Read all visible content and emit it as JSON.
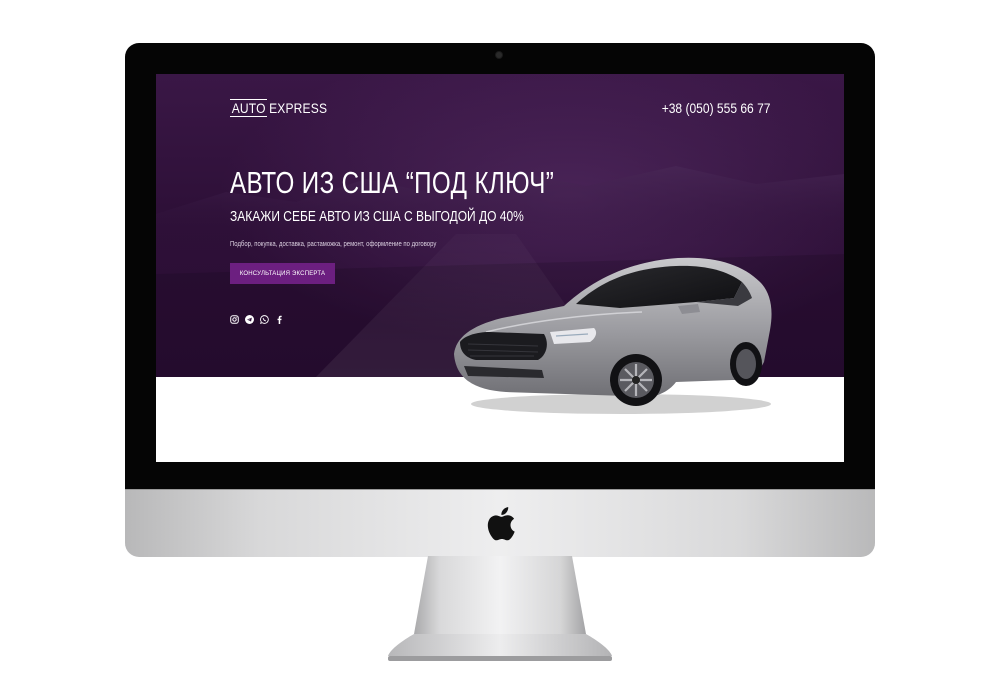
{
  "site": {
    "logo": {
      "part1": "AUTO",
      "part2": "EXPRESS"
    },
    "phone": "+38 (050) 555 66 77",
    "hero": {
      "title": "АВТО ИЗ США “ПОД КЛЮЧ”",
      "subtitle": "ЗАКАЖИ СЕБЕ АВТО ИЗ США С ВЫГОДОЙ ДО 40%",
      "description": "Подбор, покупка, доставка, растаможка, ремонт, оформление по договору",
      "cta_label": "КОНСУЛЬТАЦИЯ ЭКСПЕРТА"
    },
    "socials": [
      "instagram-icon",
      "telegram-icon",
      "whatsapp-icon",
      "facebook-icon"
    ]
  },
  "colors": {
    "hero_background": "#2e1038",
    "accent": "#6c1f80",
    "text": "#ffffff",
    "device_silver": "#d8d8d9",
    "bezel": "#050505"
  },
  "device": {
    "type": "desktop-monitor-mockup",
    "brand_icon": "apple-logo-icon"
  }
}
